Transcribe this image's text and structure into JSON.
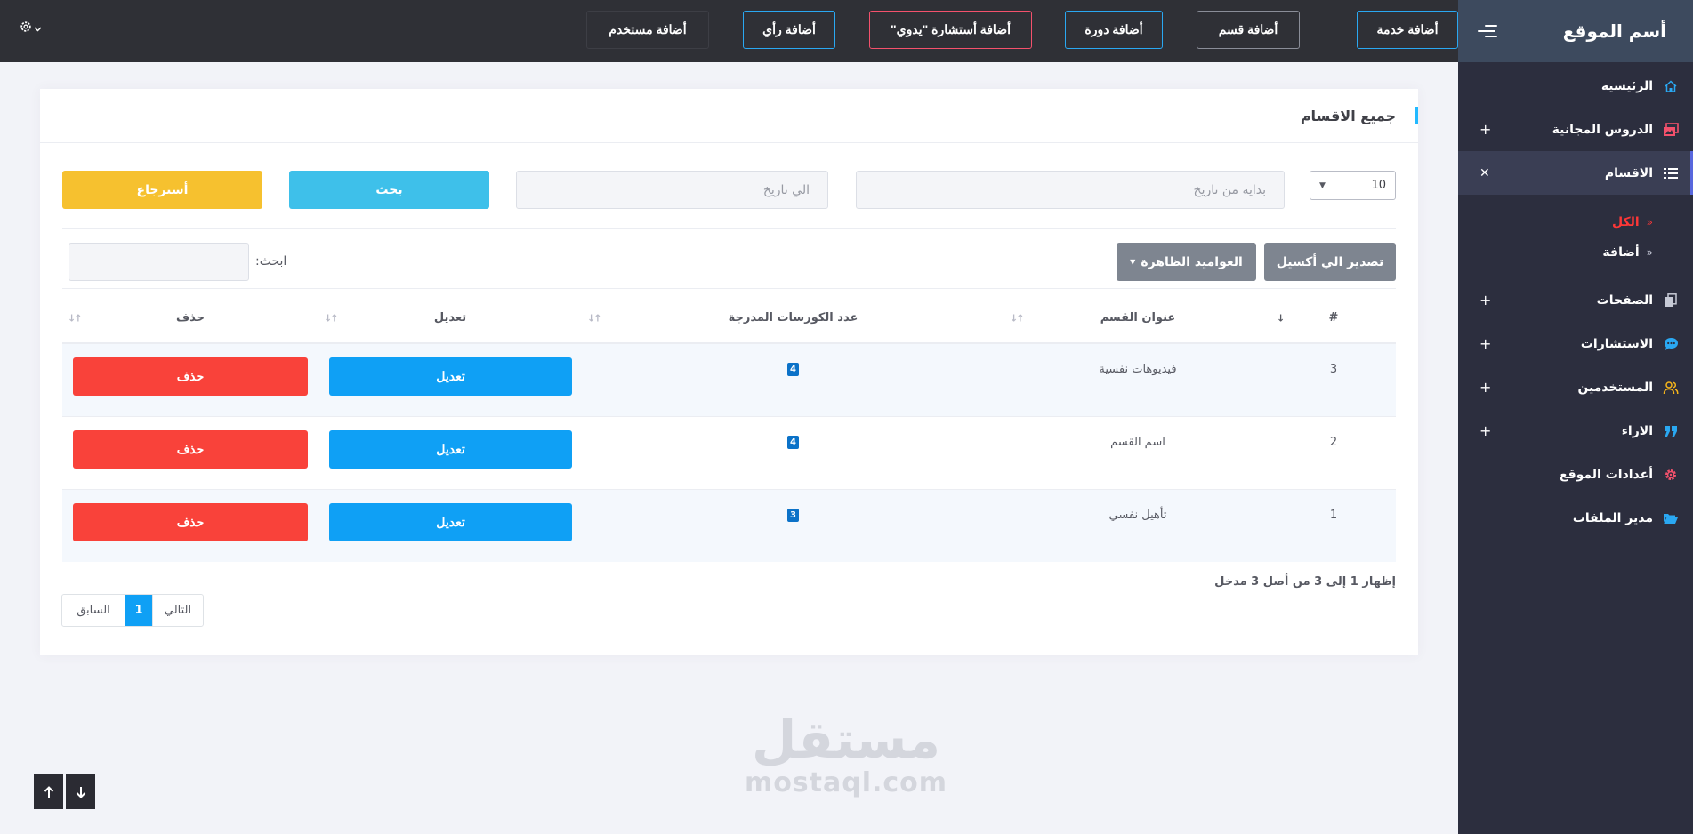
{
  "sidebar": {
    "brand": "أسم الموقع",
    "items": [
      {
        "label": "الرئيسية",
        "icon": "home-icon",
        "toggle": ""
      },
      {
        "label": "الدروس المجانية",
        "icon": "images-icon",
        "toggle": "+"
      },
      {
        "label": "الاقسام",
        "icon": "list-icon",
        "toggle": "✕"
      },
      {
        "label": "الصفحات",
        "icon": "file-copy-icon",
        "toggle": "+"
      },
      {
        "label": "الاستشارات",
        "icon": "chat-bubble-icon",
        "toggle": "+"
      },
      {
        "label": "المستخدمين",
        "icon": "users-icon",
        "toggle": "+"
      },
      {
        "label": "الاراء",
        "icon": "quote-icon",
        "toggle": "+"
      },
      {
        "label": "أعدادات الموقع",
        "icon": "gear-icon",
        "toggle": ""
      },
      {
        "label": "مدير الملفات",
        "icon": "folder-open-icon",
        "toggle": ""
      }
    ],
    "submenu": [
      {
        "label": "الكل"
      },
      {
        "label": "أضافة"
      }
    ]
  },
  "topbar": {
    "buttons": [
      {
        "label": "أضافة خدمة"
      },
      {
        "label": "أضافة قسم"
      },
      {
        "label": "أضافة دورة"
      },
      {
        "label": "أضافة أستشارة \"يدوي\""
      },
      {
        "label": "أضافة رأي"
      },
      {
        "label": "أضافة مستخدم"
      }
    ]
  },
  "card": {
    "title": "جميع الاقسام",
    "page_length": "10",
    "from_date_placeholder": "بداية من تاريخ",
    "to_date_placeholder": "الي تاريخ",
    "search_btn": "بحث",
    "reset_btn": "أسترجاع",
    "export_btn": "تصدير الي أكسيل",
    "columns_btn": "العواميد الظاهرة",
    "search_label": "ابحث:",
    "table": {
      "headers": [
        "#",
        "عنوان القسم",
        "عدد الكورسات المدرجة",
        "تعديل",
        "حذف"
      ],
      "rows": [
        {
          "id": "3",
          "title": "فيديوهات نفسية",
          "count": "4",
          "edit": "تعديل",
          "delete": "حذف"
        },
        {
          "id": "2",
          "title": "اسم القسم",
          "count": "4",
          "edit": "تعديل",
          "delete": "حذف"
        },
        {
          "id": "1",
          "title": "تأهيل نفسي",
          "count": "3",
          "edit": "تعديل",
          "delete": "حذف"
        }
      ]
    },
    "info": "إظهار 1 إلى 3 من أصل 3 مدخل",
    "pagination": {
      "prev": "السابق",
      "current": "1",
      "next": "التالي"
    }
  },
  "watermark": {
    "arabic": "مستقل",
    "latin": "mostaql.com"
  },
  "colors": {
    "sidebar_bg": "#2c2e3e",
    "topbar_bg": "#2f3036",
    "accent_blue": "#0fa0f5",
    "delete_red": "#f9423a",
    "search_cyan": "#3ec0ea",
    "reset_yellow": "#f6c12f",
    "export_gray": "#7e8590"
  }
}
